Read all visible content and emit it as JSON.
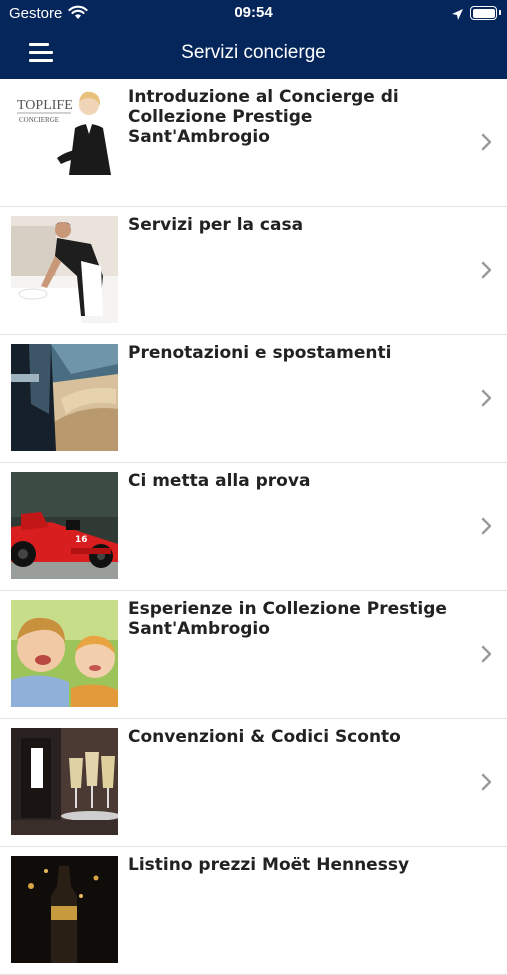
{
  "status_bar": {
    "carrier": "Gestore",
    "time": "09:54"
  },
  "header": {
    "title": "Servizi concierge"
  },
  "rows": [
    {
      "label": "Introduzione al Concierge di Collezione Prestige Sant'Ambrogio",
      "logo_line1": "TOPLIFE",
      "logo_line2": "CONCIERGE"
    },
    {
      "label": "Servizi per la casa"
    },
    {
      "label": "Prenotazioni e spostamenti"
    },
    {
      "label": "Ci metta alla prova"
    },
    {
      "label": "Esperienze in Collezione Prestige Sant'Ambrogio"
    },
    {
      "label": "Convenzioni & Codici Sconto"
    },
    {
      "label": "Listino prezzi Moët Hennessy"
    }
  ],
  "icons": [
    "wifi-icon",
    "location-arrow-icon",
    "battery-icon",
    "hamburger-menu-icon",
    "chevron-right-icon"
  ],
  "colors": {
    "header_bg": "#05265a",
    "text": "#222222",
    "chevron": "#9a9a9a"
  }
}
